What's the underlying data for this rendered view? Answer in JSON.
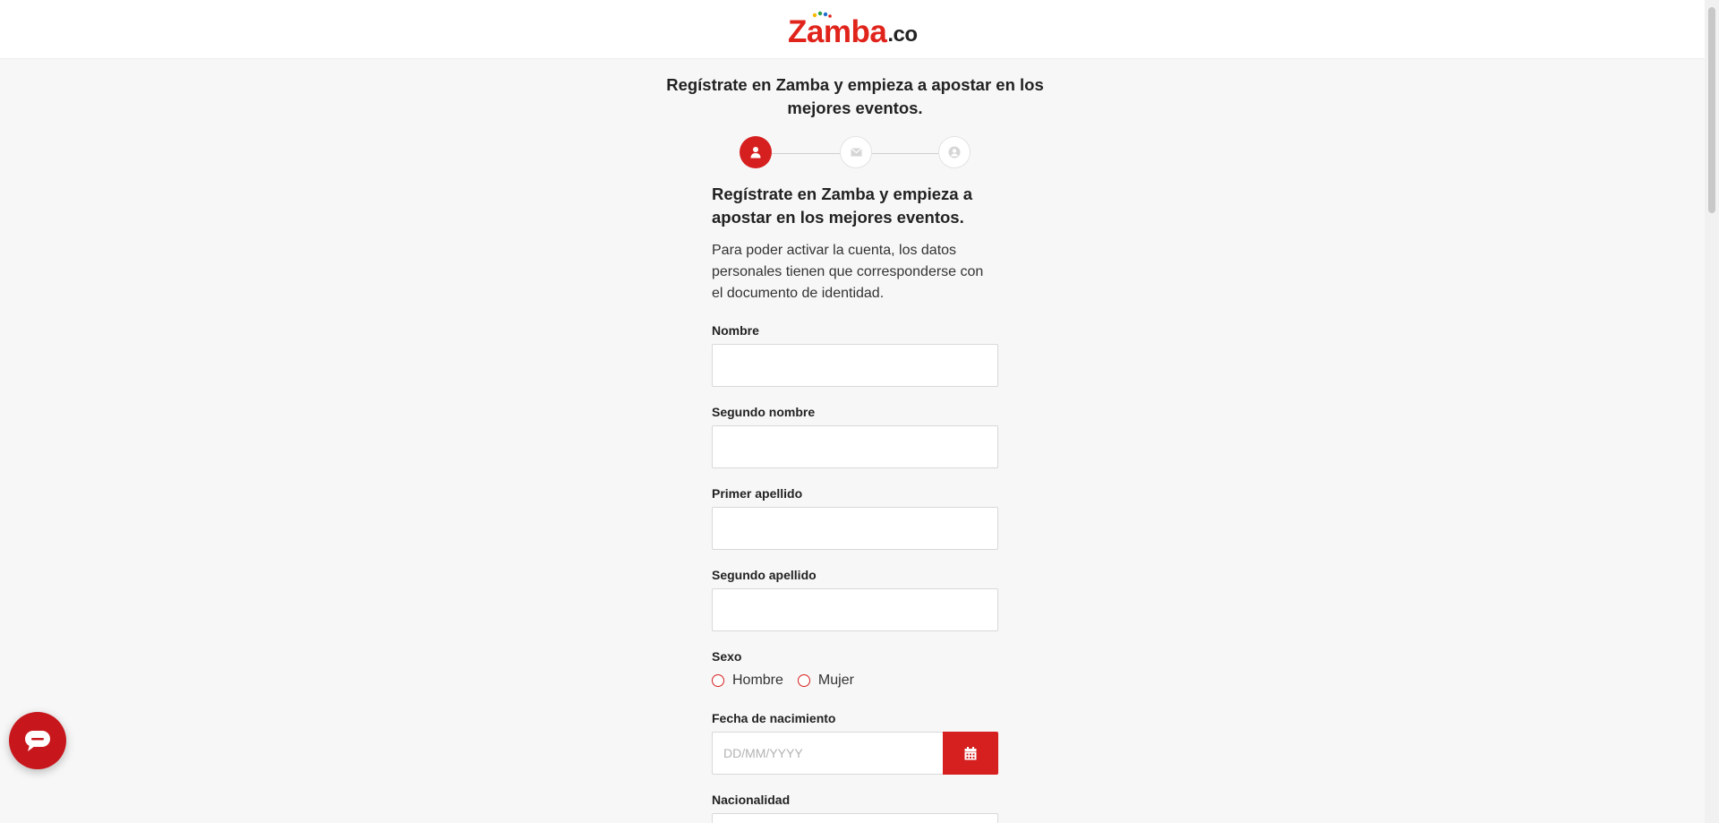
{
  "header": {
    "logo_brand": "Zamba",
    "logo_tld": ".co"
  },
  "page_heading": "Regístrate en Zamba y empieza a apostar en los mejores eventos.",
  "stepper": {
    "steps": [
      {
        "icon": "user-icon",
        "state": "active"
      },
      {
        "icon": "envelope-icon",
        "state": "inactive"
      },
      {
        "icon": "user-circle-icon",
        "state": "inactive"
      }
    ]
  },
  "form": {
    "title": "Regístrate en Zamba y empieza a apostar en los mejores eventos.",
    "description": "Para poder activar la cuenta, los datos personales tienen que corresponderse con el documento de identidad.",
    "fields": {
      "nombre_label": "Nombre",
      "nombre_value": "",
      "segundo_nombre_label": "Segundo nombre",
      "segundo_nombre_value": "",
      "primer_apellido_label": "Primer apellido",
      "primer_apellido_value": "",
      "segundo_apellido_label": "Segundo apellido",
      "segundo_apellido_value": "",
      "sexo_label": "Sexo",
      "sexo_options": [
        "Hombre",
        "Mujer"
      ],
      "fecha_label": "Fecha de nacimiento",
      "fecha_placeholder": "DD/MM/YYYY",
      "nacionalidad_label": "Nacionalidad"
    }
  },
  "colors": {
    "accent": "#d61f1f",
    "background": "#f7f7f7",
    "chat_button": "#c8171c"
  },
  "icons": {
    "calendar": "calendar-icon",
    "chat": "chat-bubble-icon"
  }
}
